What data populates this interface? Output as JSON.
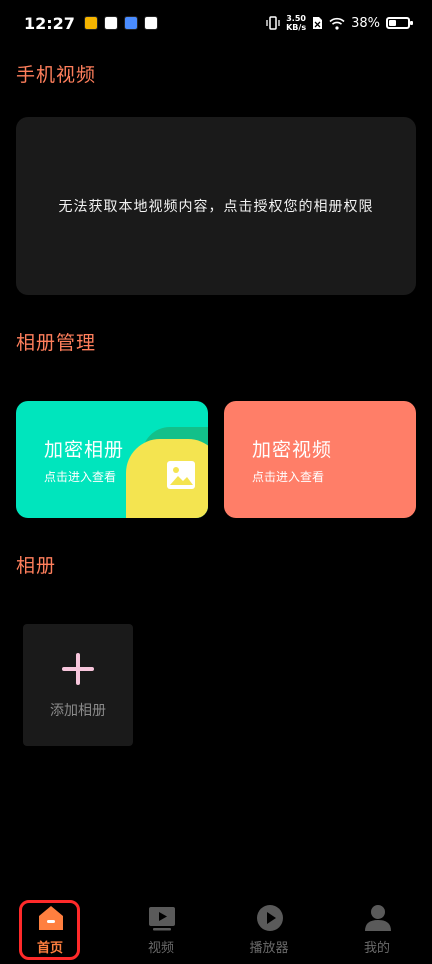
{
  "status_bar": {
    "time": "12:27",
    "speed_value": "3.50",
    "speed_unit": "KB/s",
    "battery": "38%"
  },
  "sections": {
    "phone_videos": "手机视频",
    "album_management": "相册管理",
    "albums": "相册"
  },
  "permission_card": {
    "message": "无法获取本地视频内容，点击授权您的相册权限"
  },
  "management_cards": [
    {
      "title": "加密相册",
      "subtitle": "点击进入查看"
    },
    {
      "title": "加密视频",
      "subtitle": "点击进入查看"
    }
  ],
  "add_album": {
    "label": "添加相册"
  },
  "bottom_nav": [
    {
      "label": "首页",
      "icon": "home-icon",
      "active": true
    },
    {
      "label": "视频",
      "icon": "video-icon",
      "active": false
    },
    {
      "label": "播放器",
      "icon": "player-icon",
      "active": false
    },
    {
      "label": "我的",
      "icon": "profile-icon",
      "active": false
    }
  ],
  "colors": {
    "accent": "#ff7f5c",
    "encrypted_album_card": "#00e5bd",
    "encrypted_video_card": "#ff7e68",
    "nav_active": "#ff7f3f",
    "highlight_box": "#ff2a2a"
  }
}
